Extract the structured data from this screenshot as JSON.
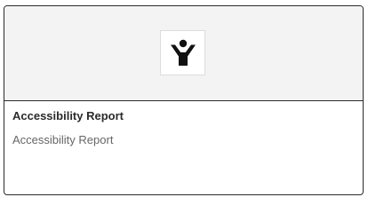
{
  "card": {
    "title": "Accessibility Report",
    "description": "Accessibility Report",
    "icon": "accessibility-person-icon"
  },
  "colors": {
    "media_background": "#f3f3f3",
    "border": "#2b2b2b",
    "title_text": "#2b2b2b",
    "description_text": "#666666"
  }
}
